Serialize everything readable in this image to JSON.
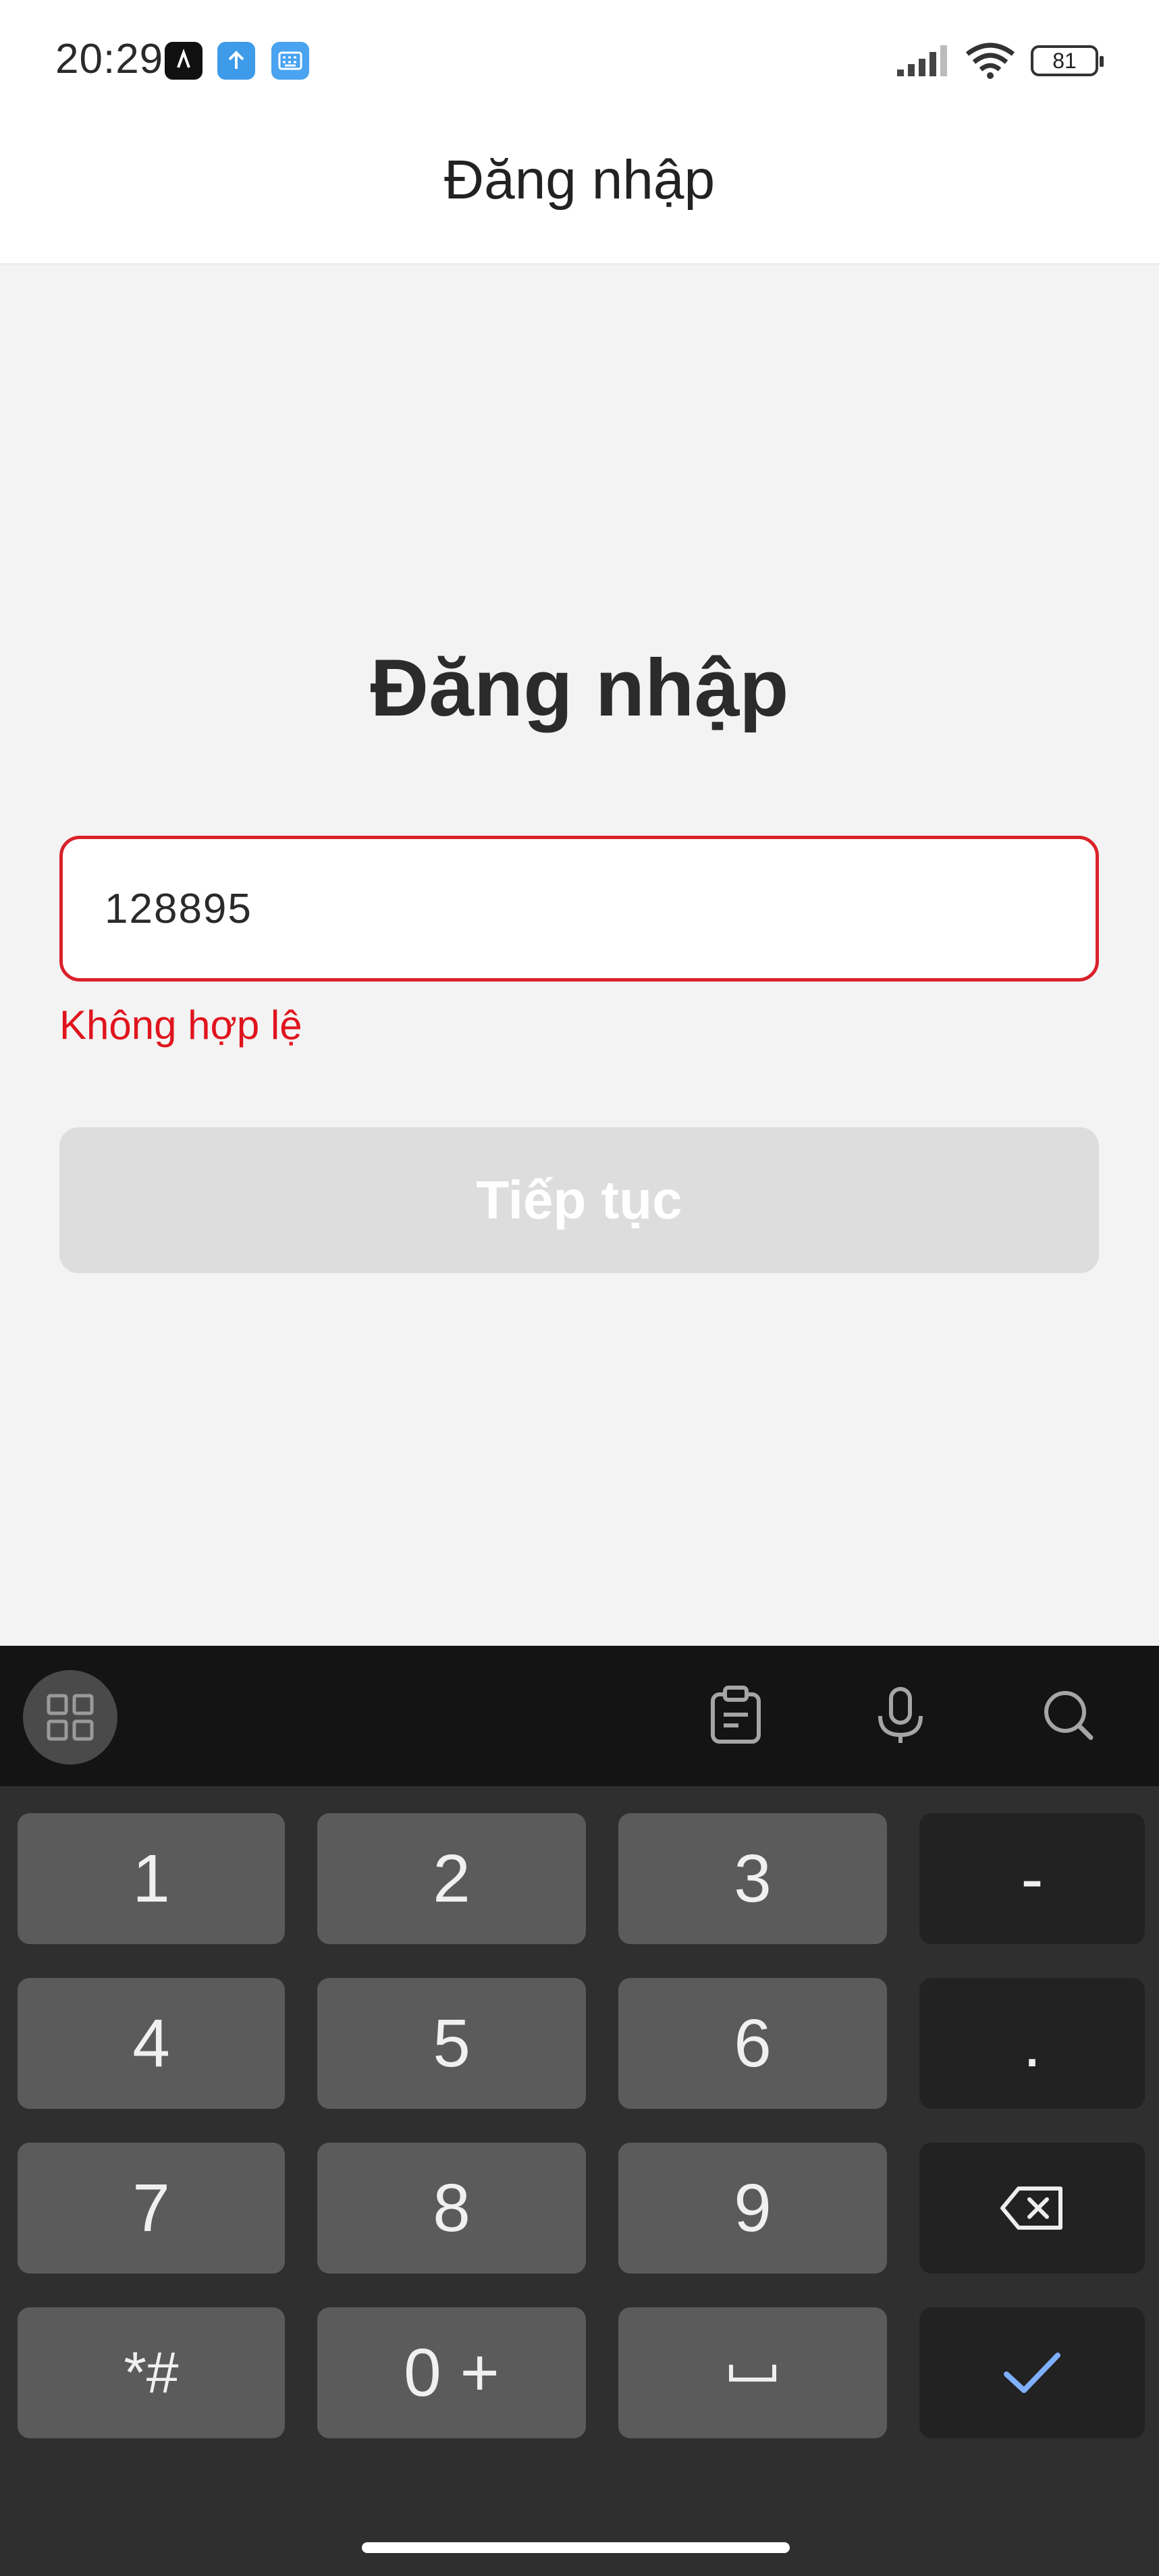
{
  "status_bar": {
    "time": "20:29",
    "battery": "81"
  },
  "header": {
    "title": "Đăng nhập"
  },
  "main": {
    "title": "Đăng nhập",
    "input_value": "128895",
    "error": "Không hợp lệ",
    "continue_label": "Tiếp tục"
  },
  "keyboard": {
    "keys": {
      "k1": "1",
      "k2": "2",
      "k3": "3",
      "dash": "-",
      "k4": "4",
      "k5": "5",
      "k6": "6",
      "dot": ".",
      "k7": "7",
      "k8": "8",
      "k9": "9",
      "symbols": "*#",
      "zero": "0 +"
    }
  },
  "colors": {
    "error": "#e0141d",
    "input_border": "#d9222a",
    "button_disabled": "#dddddd",
    "keyboard_bg": "#2f2f2f",
    "key_bg": "#5b5b5b",
    "confirm_check": "#7fb0ff"
  },
  "icons": [
    "app-icon-dark",
    "upload-icon",
    "keyboard-app-icon",
    "signal-icon",
    "wifi-icon",
    "battery-icon",
    "grid-icon",
    "clipboard-icon",
    "microphone-icon",
    "search-icon",
    "backspace-icon",
    "space-icon",
    "check-icon"
  ]
}
